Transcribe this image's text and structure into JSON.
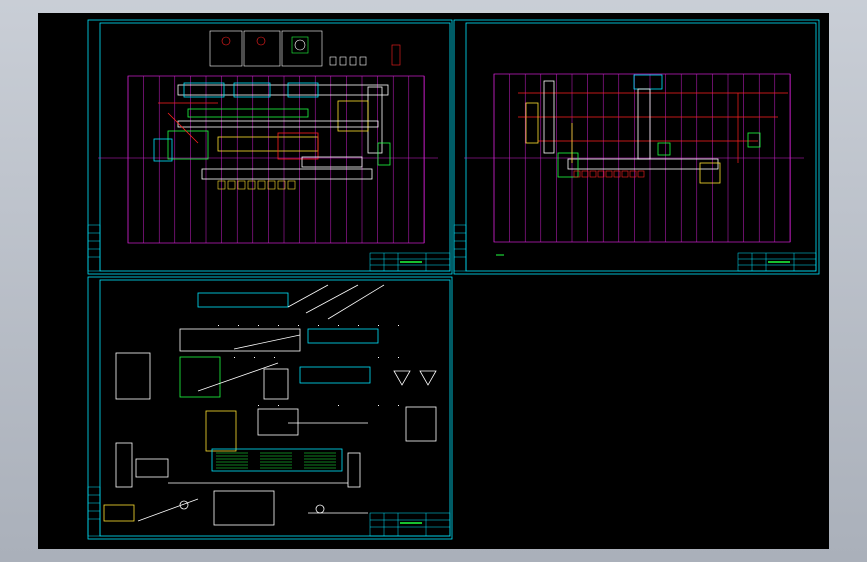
{
  "window": {
    "background_color": "#b8bec8",
    "canvas_color": "#000000"
  },
  "drawing": {
    "sheets": [
      {
        "id": "sheet-1",
        "kind": "plan-with-equipment"
      },
      {
        "id": "sheet-2",
        "kind": "plan-pipeline"
      },
      {
        "id": "sheet-3",
        "kind": "process-flow-elevation"
      }
    ],
    "colors": {
      "frame": "#00e5ff",
      "grid": "#d020d0",
      "pipe": "#ff2020",
      "equipment": "#ffffff",
      "detail": "#20ff40",
      "annotation": "#ffe030"
    }
  }
}
